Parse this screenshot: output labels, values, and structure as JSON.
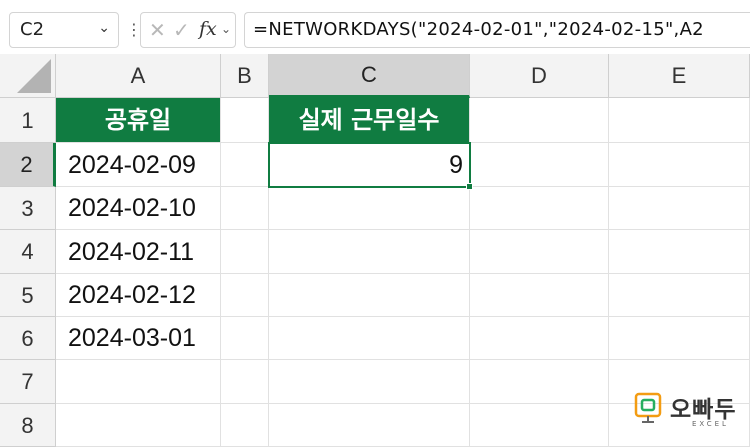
{
  "formula_bar": {
    "name_box": "C2",
    "fx_label": "fx",
    "formula": "=NETWORKDAYS(\"2024-02-01\",\"2024-02-15\",A2"
  },
  "columns": [
    "A",
    "B",
    "C",
    "D",
    "E"
  ],
  "rows": [
    "1",
    "2",
    "3",
    "4",
    "5",
    "6",
    "7",
    "8"
  ],
  "cells": {
    "A1": "공휴일",
    "A2": "2024-02-09",
    "A3": "2024-02-10",
    "A4": "2024-02-11",
    "A5": "2024-02-12",
    "A6": "2024-03-01",
    "C1": "실제 근무일수",
    "C2": "9"
  },
  "active_cell": "C2",
  "colors": {
    "accent": "#107c41",
    "header_fill": "#107c41",
    "header_text": "#ffffff"
  },
  "logo": {
    "brand": "오빠두",
    "sub": "EXCEL"
  }
}
